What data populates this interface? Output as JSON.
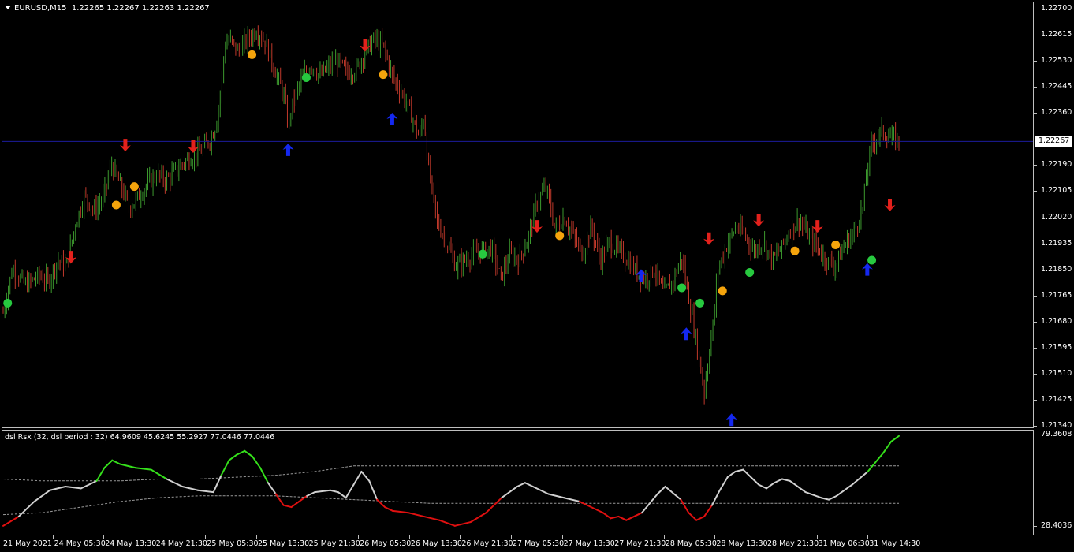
{
  "chart": {
    "symbol_info": "EURUSD,M15",
    "ohlc": "1.22265 1.22267 1.22263 1.22267",
    "current_price": "1.22267",
    "colors": {
      "up": "#3c9a2e",
      "down": "#c0392b",
      "current_line": "#1c1c9c",
      "grid": "#bfbfbf"
    }
  },
  "price_scale": [
    "1.22700",
    "1.22615",
    "1.22530",
    "1.22445",
    "1.22360",
    "1.22190",
    "1.22105",
    "1.22020",
    "1.21935",
    "1.21850",
    "1.21765",
    "1.21680",
    "1.21595",
    "1.21510",
    "1.21425",
    "1.21340"
  ],
  "indicator": {
    "title": "dsl Rsx (32, dsl period : 32) 64.9609 45.6245 55.2927 77.0446 77.0446",
    "scale": [
      "79.3608",
      "28.4036"
    ],
    "colors": {
      "bull": "#35e01b",
      "bear": "#e01010",
      "neutral": "#d0d0d0",
      "level": "#9a9a9a"
    }
  },
  "time_axis": [
    "21 May 2021",
    "24 May 05:30",
    "24 May 13:30",
    "24 May 21:30",
    "25 May 05:30",
    "25 May 13:30",
    "25 May 21:30",
    "26 May 05:30",
    "26 May 13:30",
    "26 May 21:30",
    "27 May 05:30",
    "27 May 13:30",
    "27 May 21:30",
    "28 May 05:30",
    "28 May 13:30",
    "28 May 21:30",
    "31 May 06:30",
    "31 May 14:30"
  ],
  "chart_data": {
    "type": "candlestick",
    "symbol": "EURUSD",
    "timeframe": "M15",
    "ylim": [
      1.2134,
      1.227
    ],
    "close_path": [
      [
        0,
        1.2171
      ],
      [
        2,
        1.2185
      ],
      [
        5,
        1.218
      ],
      [
        8,
        1.2183
      ],
      [
        10,
        1.2181
      ],
      [
        12,
        1.2188
      ],
      [
        14,
        1.2186
      ],
      [
        16,
        1.22
      ],
      [
        18,
        1.2209
      ],
      [
        20,
        1.2204
      ],
      [
        22,
        1.2208
      ],
      [
        24,
        1.2219
      ],
      [
        26,
        1.2212
      ],
      [
        28,
        1.2205
      ],
      [
        30,
        1.2209
      ],
      [
        32,
        1.2213
      ],
      [
        34,
        1.2216
      ],
      [
        36,
        1.2214
      ],
      [
        38,
        1.2217
      ],
      [
        40,
        1.222
      ],
      [
        42,
        1.2222
      ],
      [
        44,
        1.2224
      ],
      [
        45,
        1.2226
      ],
      [
        46,
        1.2228
      ],
      [
        47,
        1.2232
      ],
      [
        48,
        1.2242
      ],
      [
        49,
        1.2258
      ],
      [
        50,
        1.226
      ],
      [
        52,
        1.2256
      ],
      [
        54,
        1.226
      ],
      [
        56,
        1.2263
      ],
      [
        58,
        1.2259
      ],
      [
        60,
        1.225
      ],
      [
        62,
        1.2242
      ],
      [
        63,
        1.2232
      ],
      [
        64,
        1.2239
      ],
      [
        66,
        1.2247
      ],
      [
        68,
        1.2252
      ],
      [
        70,
        1.2248
      ],
      [
        72,
        1.2251
      ],
      [
        74,
        1.2253
      ],
      [
        76,
        1.2249
      ],
      [
        78,
        1.225
      ],
      [
        80,
        1.2256
      ],
      [
        82,
        1.226
      ],
      [
        84,
        1.2258
      ],
      [
        86,
        1.2248
      ],
      [
        88,
        1.2243
      ],
      [
        90,
        1.2236
      ],
      [
        92,
        1.2228
      ],
      [
        93,
        1.2235
      ],
      [
        94,
        1.2218
      ],
      [
        96,
        1.22
      ],
      [
        98,
        1.2194
      ],
      [
        100,
        1.2186
      ],
      [
        102,
        1.2188
      ],
      [
        104,
        1.219
      ],
      [
        106,
        1.2191
      ],
      [
        108,
        1.2192
      ],
      [
        110,
        1.2182
      ],
      [
        112,
        1.219
      ],
      [
        114,
        1.2188
      ],
      [
        116,
        1.2195
      ],
      [
        118,
        1.2207
      ],
      [
        120,
        1.2212
      ],
      [
        122,
        1.2198
      ],
      [
        124,
        1.2202
      ],
      [
        126,
        1.2196
      ],
      [
        128,
        1.219
      ],
      [
        130,
        1.2199
      ],
      [
        132,
        1.2188
      ],
      [
        134,
        1.2194
      ],
      [
        136,
        1.2191
      ],
      [
        138,
        1.2188
      ],
      [
        140,
        1.2184
      ],
      [
        142,
        1.2182
      ],
      [
        144,
        1.2185
      ],
      [
        146,
        1.2177
      ],
      [
        148,
        1.2181
      ],
      [
        150,
        1.2189
      ],
      [
        151,
        1.218
      ],
      [
        152,
        1.2172
      ],
      [
        154,
        1.2154
      ],
      [
        155,
        1.2145
      ],
      [
        156,
        1.2158
      ],
      [
        157,
        1.2168
      ],
      [
        158,
        1.2185
      ],
      [
        160,
        1.2193
      ],
      [
        162,
        1.2199
      ],
      [
        164,
        1.2196
      ],
      [
        166,
        1.2191
      ],
      [
        168,
        1.2194
      ],
      [
        170,
        1.2188
      ],
      [
        172,
        1.2192
      ],
      [
        174,
        1.2198
      ],
      [
        176,
        1.2201
      ],
      [
        178,
        1.2196
      ],
      [
        180,
        1.2192
      ],
      [
        182,
        1.2188
      ],
      [
        184,
        1.2186
      ],
      [
        186,
        1.2193
      ],
      [
        188,
        1.2197
      ],
      [
        190,
        1.2205
      ],
      [
        191,
        1.2218
      ],
      [
        192,
        1.2226
      ],
      [
        194,
        1.223
      ],
      [
        196,
        1.2228
      ],
      [
        198,
        1.2227
      ]
    ],
    "signals": [
      {
        "type": "dot",
        "color": "green",
        "bar": 1,
        "price": 1.2174
      },
      {
        "type": "arrow_down",
        "color": "red",
        "bar": 15,
        "price": 1.2189
      },
      {
        "type": "arrow_down",
        "color": "red",
        "bar": 27,
        "price": 1.22255
      },
      {
        "type": "dot",
        "color": "orange",
        "bar": 25,
        "price": 1.2206
      },
      {
        "type": "dot",
        "color": "orange",
        "bar": 29,
        "price": 1.2212
      },
      {
        "type": "arrow_down",
        "color": "red",
        "bar": 42,
        "price": 1.2225
      },
      {
        "type": "dot",
        "color": "orange",
        "bar": 55,
        "price": 1.2255
      },
      {
        "type": "arrow_up",
        "color": "blue",
        "bar": 63,
        "price": 1.2224
      },
      {
        "type": "dot",
        "color": "green",
        "bar": 67,
        "price": 1.22475
      },
      {
        "type": "arrow_down",
        "color": "red",
        "bar": 80,
        "price": 1.2258
      },
      {
        "type": "dot",
        "color": "orange",
        "bar": 84,
        "price": 1.22485
      },
      {
        "type": "arrow_up",
        "color": "blue",
        "bar": 86,
        "price": 1.2234
      },
      {
        "type": "dot",
        "color": "green",
        "bar": 106,
        "price": 1.219
      },
      {
        "type": "arrow_down",
        "color": "red",
        "bar": 118,
        "price": 1.2199
      },
      {
        "type": "dot",
        "color": "orange",
        "bar": 123,
        "price": 1.2196
      },
      {
        "type": "arrow_up",
        "color": "blue",
        "bar": 141,
        "price": 1.2183
      },
      {
        "type": "dot",
        "color": "green",
        "bar": 150,
        "price": 1.2179
      },
      {
        "type": "arrow_up",
        "color": "blue",
        "bar": 151,
        "price": 1.2164
      },
      {
        "type": "dot",
        "color": "green",
        "bar": 154,
        "price": 1.2174
      },
      {
        "type": "arrow_down",
        "color": "red",
        "bar": 156,
        "price": 1.2195
      },
      {
        "type": "dot",
        "color": "orange",
        "bar": 159,
        "price": 1.2178
      },
      {
        "type": "arrow_up",
        "color": "blue",
        "bar": 161,
        "price": 1.2136
      },
      {
        "type": "dot",
        "color": "green",
        "bar": 165,
        "price": 1.2184
      },
      {
        "type": "arrow_down",
        "color": "red",
        "bar": 167,
        "price": 1.2201
      },
      {
        "type": "dot",
        "color": "orange",
        "bar": 175,
        "price": 1.2191
      },
      {
        "type": "arrow_down",
        "color": "red",
        "bar": 180,
        "price": 1.2199
      },
      {
        "type": "dot",
        "color": "orange",
        "bar": 184,
        "price": 1.2193
      },
      {
        "type": "arrow_up",
        "color": "blue",
        "bar": 191,
        "price": 1.2185
      },
      {
        "type": "dot",
        "color": "green",
        "bar": 192,
        "price": 1.2188
      },
      {
        "type": "arrow_down",
        "color": "red",
        "bar": 196,
        "price": 1.2206
      }
    ],
    "indicator_series": {
      "ylim": [
        28.4036,
        79.3608
      ],
      "rsx": [
        [
          0,
          31
        ],
        [
          4,
          36
        ],
        [
          8,
          44
        ],
        [
          12,
          50
        ],
        [
          16,
          52
        ],
        [
          20,
          51
        ],
        [
          24,
          55
        ],
        [
          26,
          62
        ],
        [
          28,
          66
        ],
        [
          30,
          64
        ],
        [
          34,
          62
        ],
        [
          38,
          61
        ],
        [
          42,
          56
        ],
        [
          46,
          52
        ],
        [
          50,
          50
        ],
        [
          54,
          49
        ],
        [
          56,
          58
        ],
        [
          58,
          66
        ],
        [
          60,
          69
        ],
        [
          62,
          71
        ],
        [
          64,
          68
        ],
        [
          66,
          62
        ],
        [
          68,
          54
        ],
        [
          70,
          48
        ],
        [
          72,
          42
        ],
        [
          74,
          41
        ],
        [
          76,
          44
        ],
        [
          78,
          47
        ],
        [
          80,
          49
        ],
        [
          84,
          50
        ],
        [
          86,
          49
        ],
        [
          88,
          46
        ],
        [
          90,
          53
        ],
        [
          92,
          60
        ],
        [
          94,
          55
        ],
        [
          96,
          45
        ],
        [
          98,
          41
        ],
        [
          100,
          39
        ],
        [
          104,
          38
        ],
        [
          108,
          36
        ],
        [
          112,
          34
        ],
        [
          116,
          31
        ],
        [
          120,
          33
        ],
        [
          124,
          38
        ],
        [
          128,
          46
        ],
        [
          132,
          52
        ],
        [
          134,
          54
        ],
        [
          136,
          52
        ],
        [
          140,
          48
        ],
        [
          144,
          46
        ],
        [
          148,
          44
        ],
        [
          152,
          40
        ],
        [
          154,
          38
        ],
        [
          156,
          35
        ],
        [
          158,
          36
        ],
        [
          160,
          34
        ],
        [
          164,
          38
        ],
        [
          168,
          48
        ],
        [
          170,
          52
        ],
        [
          174,
          45
        ],
        [
          176,
          38
        ],
        [
          178,
          34
        ],
        [
          180,
          36
        ],
        [
          182,
          42
        ],
        [
          184,
          50
        ],
        [
          186,
          57
        ],
        [
          188,
          60
        ],
        [
          190,
          61
        ],
        [
          192,
          57
        ],
        [
          194,
          53
        ],
        [
          196,
          51
        ],
        [
          198,
          54
        ],
        [
          200,
          56
        ],
        [
          202,
          55
        ],
        [
          206,
          49
        ],
        [
          210,
          46
        ],
        [
          212,
          45
        ],
        [
          214,
          47
        ],
        [
          218,
          53
        ],
        [
          222,
          60
        ],
        [
          226,
          70
        ],
        [
          228,
          76
        ],
        [
          230,
          79
        ]
      ],
      "upper_level": [
        [
          0,
          56
        ],
        [
          10,
          55
        ],
        [
          20,
          55
        ],
        [
          30,
          55
        ],
        [
          40,
          56
        ],
        [
          50,
          56
        ],
        [
          60,
          57
        ],
        [
          70,
          58
        ],
        [
          80,
          60
        ],
        [
          90,
          63
        ],
        [
          100,
          63
        ],
        [
          110,
          63
        ],
        [
          120,
          63
        ],
        [
          130,
          63
        ],
        [
          140,
          63
        ],
        [
          150,
          63
        ],
        [
          160,
          63
        ],
        [
          170,
          63
        ],
        [
          180,
          63
        ],
        [
          190,
          63
        ],
        [
          200,
          63
        ],
        [
          210,
          63
        ],
        [
          220,
          63
        ],
        [
          230,
          63
        ]
      ],
      "lower_level": [
        [
          0,
          37
        ],
        [
          10,
          38
        ],
        [
          20,
          41
        ],
        [
          30,
          44
        ],
        [
          40,
          46
        ],
        [
          50,
          47
        ],
        [
          60,
          47
        ],
        [
          70,
          47
        ],
        [
          80,
          46
        ],
        [
          90,
          45
        ],
        [
          100,
          44
        ],
        [
          110,
          43
        ],
        [
          120,
          43
        ],
        [
          130,
          43
        ],
        [
          140,
          43
        ],
        [
          150,
          43
        ],
        [
          160,
          43
        ],
        [
          170,
          43
        ],
        [
          180,
          43
        ],
        [
          190,
          43
        ],
        [
          200,
          43
        ],
        [
          210,
          43
        ],
        [
          220,
          43
        ],
        [
          230,
          43
        ]
      ]
    }
  }
}
